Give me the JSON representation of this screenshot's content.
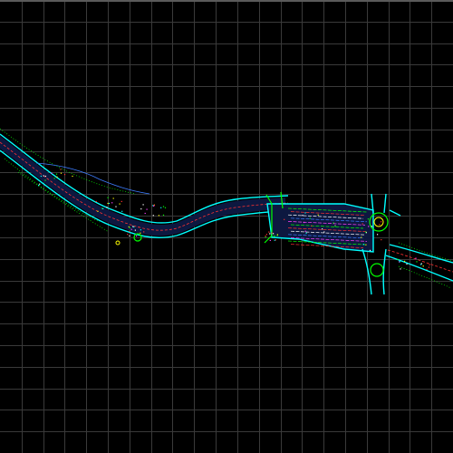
{
  "viewport": {
    "background_color": "#000000",
    "grid_color": "#3a3a3a",
    "top_border_color": "#5a5a5a",
    "drawing_colors": {
      "road_outline": "#00ffff",
      "road_fill": "#0d1840",
      "vegetation": "#00ff00",
      "annotation": "#ff3030",
      "secondary": "#3d7dff",
      "highlight": "#ffff00",
      "structure": "#ff40ff",
      "text_marks": "#ffffff"
    },
    "icons": {
      "grid": "grid-icon",
      "drawing": "road-drawing-icon"
    }
  }
}
